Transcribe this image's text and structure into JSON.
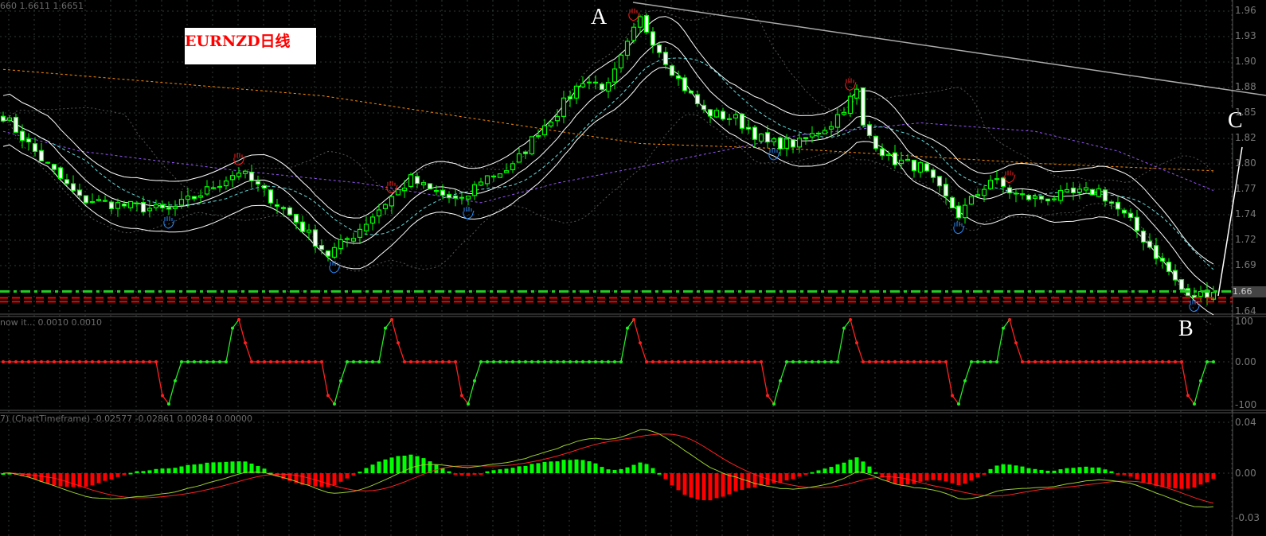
{
  "header": {
    "ohlc_text": "660 1.6611 1.6651"
  },
  "title": "EURNZD日线",
  "annotations": {
    "a": "A",
    "b": "B",
    "c": "C"
  },
  "price_axis": {
    "ticks": [
      "1.96",
      "1.93",
      "1.90",
      "1.88",
      "1.85",
      "1.82",
      "1.80",
      "1.77",
      "1.74",
      "1.72",
      "1.69",
      "1.66",
      "1.64"
    ],
    "current_price": "1.66"
  },
  "panel2": {
    "label": "now it...  0.0010 0.0010",
    "ticks": [
      "100",
      "0.00",
      "-100"
    ]
  },
  "panel3": {
    "label": "7) (ChartTimeframe) -0.02577 -0.02861 0.00284 0.00000",
    "ticks": [
      "0.04",
      "0.00",
      "-0.03"
    ]
  },
  "colors": {
    "bull_border": "#00ff00",
    "bear_fill": "#ffffff",
    "envelope": "#ffffff",
    "cyan_ma": "#66dddd",
    "purple_ma": "#9955ff",
    "orange_ma": "#ff8c00",
    "bollinger": "#555555",
    "hist_up": "#00ff00",
    "hist_down": "#ff0000",
    "macd": "#9acd32",
    "signal": "#ff2020",
    "level_green": "#22cc22",
    "level_red": "#ff0000",
    "trendline": "#aaaaaa"
  },
  "chart_data": {
    "type": "candlestick",
    "symbol": "EURNZD",
    "timeframe": "D1",
    "candle_count": 191,
    "ylim": [
      1.645,
      1.965
    ],
    "close_path": [
      [
        0,
        1.854
      ],
      [
        6,
        1.8075
      ],
      [
        12,
        1.765
      ],
      [
        19,
        1.758
      ],
      [
        26,
        1.7525
      ],
      [
        32,
        1.774
      ],
      [
        37,
        1.795
      ],
      [
        40,
        1.778
      ],
      [
        45,
        1.748
      ],
      [
        51,
        1.706
      ],
      [
        55,
        1.727
      ],
      [
        60,
        1.761
      ],
      [
        64,
        1.786
      ],
      [
        67,
        1.774
      ],
      [
        72,
        1.761
      ],
      [
        75,
        1.786
      ],
      [
        80,
        1.799
      ],
      [
        84,
        1.837
      ],
      [
        87,
        1.858
      ],
      [
        91,
        1.892
      ],
      [
        95,
        1.884
      ],
      [
        99,
        1.943
      ],
      [
        100,
        1.956
      ],
      [
        102,
        1.9345
      ],
      [
        106,
        1.892
      ],
      [
        110,
        1.858
      ],
      [
        115,
        1.85
      ],
      [
        120,
        1.824
      ],
      [
        125,
        1.824
      ],
      [
        130,
        1.8456
      ],
      [
        134,
        1.8795
      ],
      [
        135,
        1.841
      ],
      [
        139,
        1.8075
      ],
      [
        144,
        1.799
      ],
      [
        150,
        1.748
      ],
      [
        155,
        1.786
      ],
      [
        159,
        1.769
      ],
      [
        162,
        1.765
      ],
      [
        167,
        1.769
      ],
      [
        172,
        1.774
      ],
      [
        177,
        1.74
      ],
      [
        182,
        1.697
      ],
      [
        186,
        1.659
      ],
      [
        190,
        1.668
      ]
    ],
    "orange_ma": [
      [
        0,
        1.903
      ],
      [
        50,
        1.875
      ],
      [
        100,
        1.824
      ],
      [
        125,
        1.818
      ],
      [
        162,
        1.803
      ],
      [
        190,
        1.795
      ]
    ],
    "purple_ma": [
      [
        0,
        1.837
      ],
      [
        12,
        1.816
      ],
      [
        37,
        1.795
      ],
      [
        56,
        1.782
      ],
      [
        75,
        1.761
      ],
      [
        87,
        1.782
      ],
      [
        106,
        1.807
      ],
      [
        125,
        1.833
      ],
      [
        144,
        1.846
      ],
      [
        162,
        1.837
      ],
      [
        175,
        1.816
      ],
      [
        190,
        1.774
      ]
    ],
    "fractals_up": [
      37,
      61,
      99,
      133,
      158
    ],
    "fractals_down": [
      26,
      52,
      73,
      121,
      150,
      187
    ],
    "horizontal_levels": [
      {
        "price": 1.6665,
        "style": "dash-dot",
        "color": "green"
      },
      {
        "price": 1.6598,
        "style": "dashed",
        "color": "red"
      },
      {
        "price": 1.6556,
        "style": "dashed",
        "color": "red"
      }
    ],
    "zigzag_events": [
      {
        "i": 26,
        "dir": -1
      },
      {
        "i": 37,
        "dir": 1
      },
      {
        "i": 52,
        "dir": -1
      },
      {
        "i": 61,
        "dir": 1
      },
      {
        "i": 73,
        "dir": -1
      },
      {
        "i": 99,
        "dir": 1
      },
      {
        "i": 121,
        "dir": -1
      },
      {
        "i": 133,
        "dir": 1
      },
      {
        "i": 150,
        "dir": -1
      },
      {
        "i": 158,
        "dir": 1
      },
      {
        "i": 187,
        "dir": -1
      }
    ],
    "zigzag_range": [
      -100,
      100
    ],
    "macd_range": [
      -0.035,
      0.045
    ]
  }
}
